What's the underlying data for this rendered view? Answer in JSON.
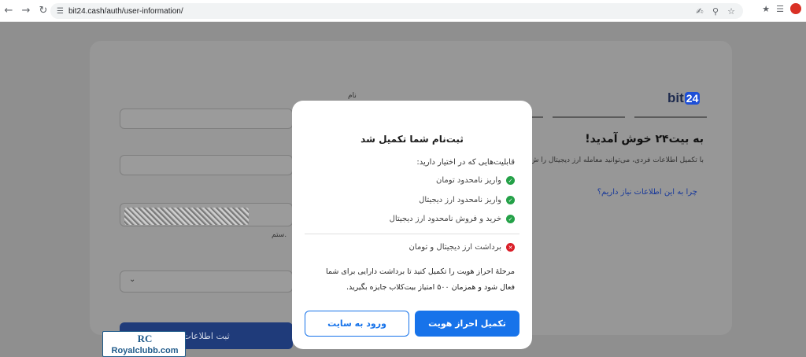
{
  "browser": {
    "url": "bit24.cash/auth/user-information/"
  },
  "page": {
    "logo_text": "bit",
    "logo_num": "24",
    "welcome_title": "به بیت۲۴ خوش آمدید!",
    "welcome_sub": "با تکمیل اطلاعات فردی، می‌توانید معامله ارز دیجیتال را ش",
    "why_link": "چرا به این اطلاعات نیاز داریم؟",
    "name_label": "نام",
    "accept_text": "ستم.",
    "submit_label": "ثبت اطلاعات"
  },
  "modal": {
    "title": "ثبت‌نام شما تکمیل شد",
    "capabilities_heading": "قابلیت‌هایی که در اختیار دارید:",
    "capabilities": [
      "واریز نامحدود تومان",
      "واریز نامحدود ارز دیجیتال",
      "خرید و فروش نامحدود ارز دیجیتال"
    ],
    "restriction": "برداشت ارز دیجیتال و تومان",
    "note": "مرحلهٔ احراز هویت را تکمیل کنید تا برداشت دارایی برای شما فعال شود و همزمان ۵۰۰ امتیاز بیت‌کلاب جایزه بگیرید.",
    "primary_button": "تکمیل احراز هویت",
    "secondary_button": "ورود به سایت"
  },
  "watermark": {
    "mark": "RC",
    "text": "Royalclubb.com"
  },
  "colors": {
    "primary": "#1773ea",
    "success": "#24a148",
    "danger": "#da1e28"
  }
}
